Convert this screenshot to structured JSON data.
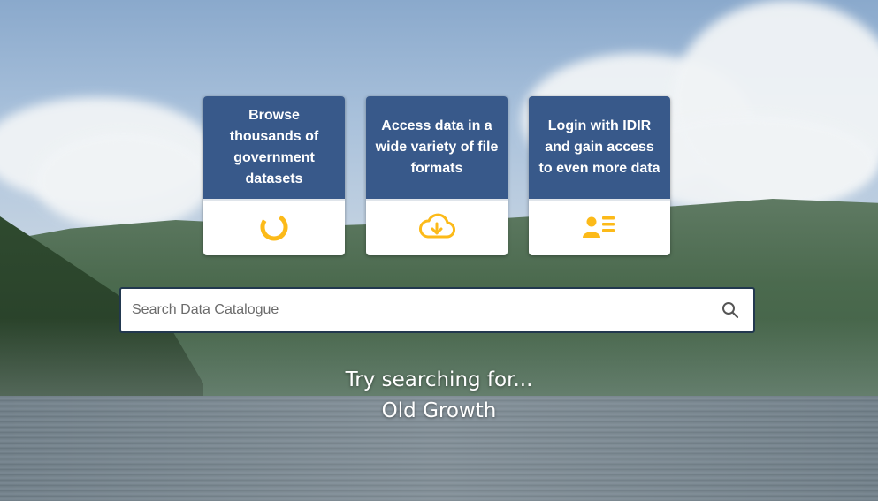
{
  "cards": [
    {
      "title": "Browse thousands of government datasets",
      "icon": "donut-chart-icon"
    },
    {
      "title": "Access data in a wide variety of file formats",
      "icon": "cloud-download-icon"
    },
    {
      "title": "Login with IDIR and gain access to even more data",
      "icon": "user-list-icon"
    }
  ],
  "search": {
    "placeholder": "Search Data Catalogue",
    "value": "",
    "icon": "search-icon"
  },
  "suggestions": {
    "label": "Try searching for...",
    "item": "Old Growth"
  },
  "colors": {
    "card_header": "#38598a",
    "icon_accent": "#fcba19",
    "search_border": "#22384f"
  }
}
